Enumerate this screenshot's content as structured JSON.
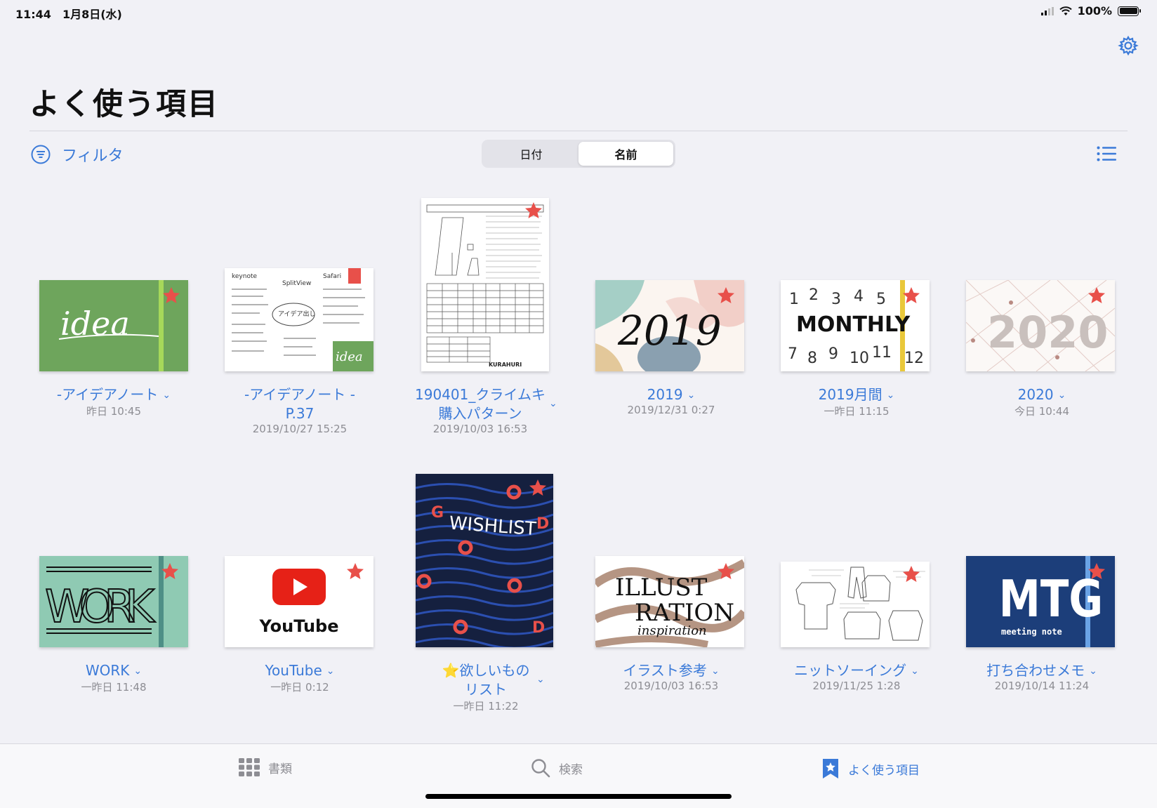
{
  "status": {
    "time": "11:44",
    "date": "1月8日(水)",
    "battery": "100%"
  },
  "header": {
    "title": "よく使う項目",
    "filter_label": "フィルタ"
  },
  "sort": {
    "options": [
      "日付",
      "名前"
    ],
    "selected": "名前"
  },
  "icons": {
    "settings": "gear-icon",
    "filter": "filter-icon",
    "view": "list-icon",
    "favorite": "star-icon"
  },
  "colors": {
    "accent": "#3b7ad8",
    "star": "#e8504a"
  },
  "documents": [
    {
      "line1": "-アイデアノート",
      "line2": "",
      "date": "昨日 10:45"
    },
    {
      "line1": "-アイデアノート -",
      "line2": "P.37",
      "date": "2019/10/27 15:25"
    },
    {
      "line1": "190401_クライムキ",
      "line2": "購入パターン",
      "date": "2019/10/03 16:53"
    },
    {
      "line1": "2019",
      "line2": "",
      "date": "2019/12/31 0:27"
    },
    {
      "line1": "2019月間",
      "line2": "",
      "date": "一昨日 11:15"
    },
    {
      "line1": "2020",
      "line2": "",
      "date": "今日 10:44"
    },
    {
      "line1": "WORK",
      "line2": "",
      "date": "一昨日 11:48"
    },
    {
      "line1": "YouTube",
      "line2": "",
      "date": "一昨日 0:12"
    },
    {
      "line1": "⭐️欲しいもの",
      "line2": "リスト",
      "date": "一昨日 11:22"
    },
    {
      "line1": "イラスト参考",
      "line2": "",
      "date": "2019/10/03 16:53"
    },
    {
      "line1": "ニットソーイング",
      "line2": "",
      "date": "2019/11/25 1:28"
    },
    {
      "line1": "打ち合わせメモ",
      "line2": "",
      "date": "2019/10/14 11:24"
    }
  ],
  "covers": {
    "idea": "idea",
    "note_handwriting": [
      "keynote",
      "Safari",
      "SplitView",
      "アイデア出し"
    ],
    "note_idea": "idea",
    "pattern_footer": "KURAHURI",
    "y2019": "2019",
    "monthly": "MONTHLY",
    "y2020": "2020",
    "work": "WORK",
    "youtube": "YouTube",
    "wishlist": "WISHLIST",
    "illust": [
      "ILLUST",
      "RATION",
      "inspiration"
    ],
    "mtg": "MTG",
    "mtg_sub": "meeting note"
  },
  "tabs": [
    {
      "label": "書類",
      "icon": "grid-icon"
    },
    {
      "label": "検索",
      "icon": "search-icon"
    },
    {
      "label": "よく使う項目",
      "icon": "bookmark-star-icon"
    }
  ]
}
